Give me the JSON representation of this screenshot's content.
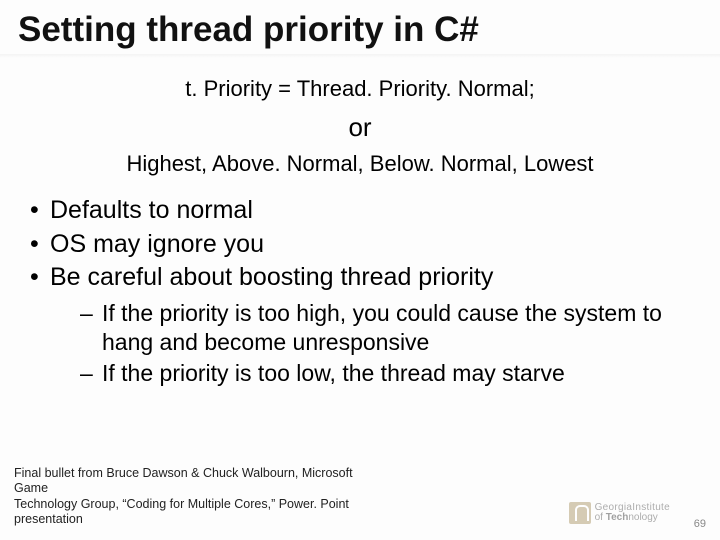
{
  "title": "Setting thread priority in C#",
  "code_line": "t. Priority = Thread. Priority. Normal;",
  "or_text": "or",
  "options_line": "Highest, Above. Normal, Below. Normal, Lowest",
  "bullets": [
    "Defaults to normal",
    "OS may ignore you",
    "Be careful about boosting thread priority"
  ],
  "sub_bullets": [
    "If the priority is too high, you could cause the system to hang and become unresponsive",
    "If the priority is too low, the thread may starve"
  ],
  "footnote_line1": "Final bullet from Bruce Dawson & Chuck Walbourn, Microsoft Game",
  "footnote_line2": "Technology Group, “Coding for Multiple Cores,” Power. Point presentation",
  "logo": {
    "line1": "GeorgiaInstitute",
    "line2a": "of ",
    "line2b": "Tech",
    "line2c": "nology"
  },
  "page_number": "69"
}
